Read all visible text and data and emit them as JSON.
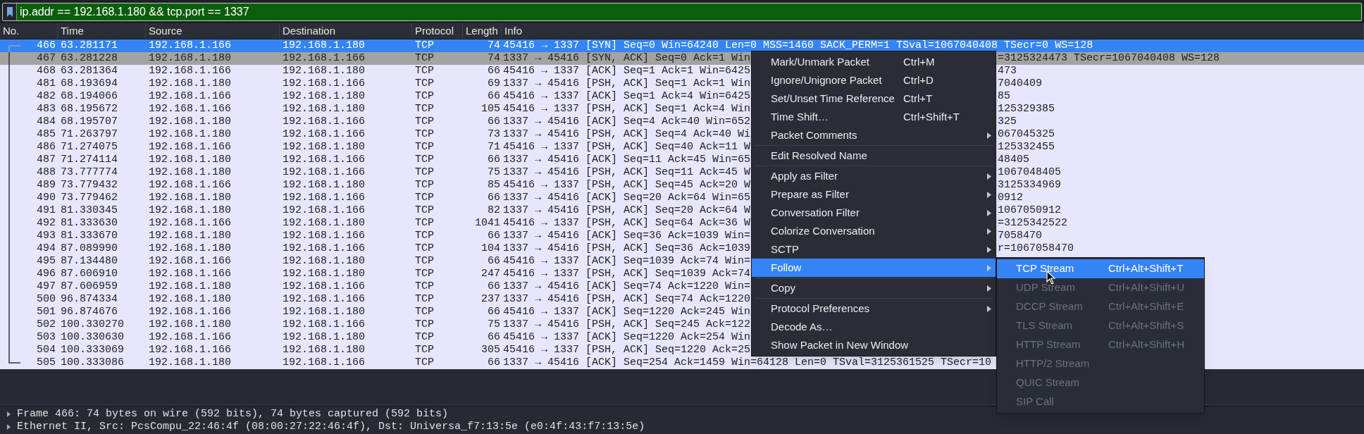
{
  "filter": {
    "value": "ip.addr == 192.168.1.180 && tcp.port == 1337"
  },
  "table": {
    "columns": [
      "No.",
      "Time",
      "Source",
      "Destination",
      "Protocol",
      "Length",
      "Info"
    ],
    "rows": [
      {
        "no": "466",
        "time": "63.281171",
        "source": "192.168.1.166",
        "destination": "192.168.1.180",
        "protocol": "TCP",
        "length": "74",
        "info": "45416 → 1337 [SYN] Seq=0 Win=64240 Len=0 MSS=1460 SACK_PERM=1 TSval=1067040408 TSecr=0 WS=128",
        "selected": true,
        "highlighted": false
      },
      {
        "no": "467",
        "time": "63.281228",
        "source": "192.168.1.180",
        "destination": "192.168.1.166",
        "protocol": "TCP",
        "length": "74",
        "info": "1337 → 45416 [SYN, ACK] Seq=0 Ack=1 Win",
        "info_tail": "=3125324473 TSecr=1067040408 WS=128",
        "selected": false,
        "highlighted": true
      },
      {
        "no": "468",
        "time": "63.281364",
        "source": "192.168.1.166",
        "destination": "192.168.1.180",
        "protocol": "TCP",
        "length": "66",
        "info": "45416 → 1337 [ACK] Seq=1 Ack=1 Win=6425",
        "info_tail": "473",
        "selected": false,
        "highlighted": false
      },
      {
        "no": "481",
        "time": "68.193694",
        "source": "192.168.1.180",
        "destination": "192.168.1.166",
        "protocol": "TCP",
        "length": "69",
        "info": "1337 → 45416 [PSH, ACK] Seq=1 Ack=1 Win",
        "info_tail": "7040409",
        "selected": false,
        "highlighted": false
      },
      {
        "no": "482",
        "time": "68.194066",
        "source": "192.168.1.166",
        "destination": "192.168.1.180",
        "protocol": "TCP",
        "length": "66",
        "info": "45416 → 1337 [ACK] Seq=1 Ack=4 Win=6425",
        "info_tail": "85",
        "selected": false,
        "highlighted": false
      },
      {
        "no": "483",
        "time": "68.195672",
        "source": "192.168.1.166",
        "destination": "192.168.1.180",
        "protocol": "TCP",
        "length": "105",
        "info": "45416 → 1337 [PSH, ACK] Seq=1 Ack=4 Win",
        "info_tail": "125329385",
        "selected": false,
        "highlighted": false
      },
      {
        "no": "484",
        "time": "68.195707",
        "source": "192.168.1.180",
        "destination": "192.168.1.166",
        "protocol": "TCP",
        "length": "66",
        "info": "1337 → 45416 [ACK] Seq=4 Ack=40 Win=652",
        "info_tail": "325",
        "selected": false,
        "highlighted": false
      },
      {
        "no": "485",
        "time": "71.263797",
        "source": "192.168.1.180",
        "destination": "192.168.1.166",
        "protocol": "TCP",
        "length": "73",
        "info": "1337 → 45416 [PSH, ACK] Seq=4 Ack=40 Wi",
        "info_tail": "067045325",
        "selected": false,
        "highlighted": false
      },
      {
        "no": "486",
        "time": "71.274075",
        "source": "192.168.1.166",
        "destination": "192.168.1.180",
        "protocol": "TCP",
        "length": "71",
        "info": "45416 → 1337 [PSH, ACK] Seq=40 Ack=11 W",
        "info_tail": "125332455",
        "selected": false,
        "highlighted": false
      },
      {
        "no": "487",
        "time": "71.274114",
        "source": "192.168.1.180",
        "destination": "192.168.1.166",
        "protocol": "TCP",
        "length": "66",
        "info": "1337 → 45416 [ACK] Seq=11 Ack=45 Win=65",
        "info_tail": "48405",
        "selected": false,
        "highlighted": false
      },
      {
        "no": "488",
        "time": "73.777774",
        "source": "192.168.1.180",
        "destination": "192.168.1.166",
        "protocol": "TCP",
        "length": "75",
        "info": "1337 → 45416 [PSH, ACK] Seq=11 Ack=45 W",
        "info_tail": "1067048405",
        "selected": false,
        "highlighted": false
      },
      {
        "no": "489",
        "time": "73.779432",
        "source": "192.168.1.166",
        "destination": "192.168.1.180",
        "protocol": "TCP",
        "length": "85",
        "info": "45416 → 1337 [PSH, ACK] Seq=45 Ack=20 W",
        "info_tail": "3125334969",
        "selected": false,
        "highlighted": false
      },
      {
        "no": "490",
        "time": "73.779462",
        "source": "192.168.1.180",
        "destination": "192.168.1.166",
        "protocol": "TCP",
        "length": "66",
        "info": "1337 → 45416 [ACK] Seq=20 Ack=64 Win=65",
        "info_tail": "0912",
        "selected": false,
        "highlighted": false
      },
      {
        "no": "491",
        "time": "81.330345",
        "source": "192.168.1.180",
        "destination": "192.168.1.166",
        "protocol": "TCP",
        "length": "82",
        "info": "1337 → 45416 [PSH, ACK] Seq=20 Ack=64 W",
        "info_tail": "1067050912",
        "selected": false,
        "highlighted": false
      },
      {
        "no": "492",
        "time": "81.333630",
        "source": "192.168.1.166",
        "destination": "192.168.1.180",
        "protocol": "TCP",
        "length": "1041",
        "info": "45416 → 1337 [PSH, ACK] Seq=64 Ack=36 W",
        "info_tail": "=3125342522",
        "selected": false,
        "highlighted": false
      },
      {
        "no": "493",
        "time": "81.333670",
        "source": "192.168.1.180",
        "destination": "192.168.1.166",
        "protocol": "TCP",
        "length": "66",
        "info": "1337 → 45416 [ACK] Seq=36 Ack=1039 Win=",
        "info_tail": "7058470",
        "selected": false,
        "highlighted": false
      },
      {
        "no": "494",
        "time": "87.089990",
        "source": "192.168.1.180",
        "destination": "192.168.1.166",
        "protocol": "TCP",
        "length": "104",
        "info": "1337 → 45416 [PSH, ACK] Seq=36 Ack=1039",
        "info_tail": "r=1067058470",
        "selected": false,
        "highlighted": false
      },
      {
        "no": "495",
        "time": "87.134480",
        "source": "192.168.1.166",
        "destination": "192.168.1.180",
        "protocol": "TCP",
        "length": "66",
        "info": "45416 → 1337 [ACK] Seq=1039 Ack=74 Win=",
        "selected": false,
        "highlighted": false
      },
      {
        "no": "496",
        "time": "87.606910",
        "source": "192.168.1.166",
        "destination": "192.168.1.180",
        "protocol": "TCP",
        "length": "247",
        "info": "45416 → 1337 [PSH, ACK] Seq=1039 Ack=74",
        "selected": false,
        "highlighted": false
      },
      {
        "no": "497",
        "time": "87.606959",
        "source": "192.168.1.180",
        "destination": "192.168.1.166",
        "protocol": "TCP",
        "length": "66",
        "info": "1337 → 45416 [ACK] Seq=74 Ack=1220 Win=",
        "selected": false,
        "highlighted": false
      },
      {
        "no": "500",
        "time": "96.874334",
        "source": "192.168.1.180",
        "destination": "192.168.1.166",
        "protocol": "TCP",
        "length": "237",
        "info": "1337 → 45416 [PSH, ACK] Seq=74 Ack=1220",
        "selected": false,
        "highlighted": false
      },
      {
        "no": "501",
        "time": "96.874676",
        "source": "192.168.1.166",
        "destination": "192.168.1.180",
        "protocol": "TCP",
        "length": "66",
        "info": "45416 → 1337 [ACK] Seq=1220 Ack=245 Win",
        "selected": false,
        "highlighted": false
      },
      {
        "no": "502",
        "time": "100.330270",
        "source": "192.168.1.180",
        "destination": "192.168.1.166",
        "protocol": "TCP",
        "length": "75",
        "info": "1337 → 45416 [PSH, ACK] Seq=245 Ack=122",
        "selected": false,
        "highlighted": false
      },
      {
        "no": "503",
        "time": "100.330630",
        "source": "192.168.1.166",
        "destination": "192.168.1.180",
        "protocol": "TCP",
        "length": "66",
        "info": "45416 → 1337 [ACK] Seq=1220 Ack=254 Win",
        "selected": false,
        "highlighted": false
      },
      {
        "no": "504",
        "time": "100.333069",
        "source": "192.168.1.166",
        "destination": "192.168.1.180",
        "protocol": "TCP",
        "length": "305",
        "info": "45416 → 1337 [PSH, ACK] Seq=1220 Ack=25",
        "selected": false,
        "highlighted": false
      },
      {
        "no": "505",
        "time": "100.333086",
        "source": "192.168.1.180",
        "destination": "192.168.1.166",
        "protocol": "TCP",
        "length": "66",
        "info": "1337 → 45416 [ACK] Seq=254 Ack=1459 Win=64128 Len=0 TSval=3125361525 TSecr=10",
        "selected": false,
        "highlighted": false
      }
    ]
  },
  "context_menu": {
    "items": [
      {
        "kind": "item",
        "label": "Mark/Unmark Packet",
        "shortcut": "Ctrl+M",
        "submenu": false,
        "selected": false
      },
      {
        "kind": "item",
        "label": "Ignore/Unignore Packet",
        "shortcut": "Ctrl+D",
        "submenu": false,
        "selected": false
      },
      {
        "kind": "item",
        "label": "Set/Unset Time Reference",
        "shortcut": "Ctrl+T",
        "submenu": false,
        "selected": false
      },
      {
        "kind": "item",
        "label": "Time Shift…",
        "shortcut": "Ctrl+Shift+T",
        "submenu": false,
        "selected": false
      },
      {
        "kind": "item",
        "label": "Packet Comments",
        "submenu": true,
        "selected": false
      },
      {
        "kind": "separator"
      },
      {
        "kind": "item",
        "label": "Edit Resolved Name",
        "submenu": false,
        "selected": false
      },
      {
        "kind": "separator"
      },
      {
        "kind": "item",
        "label": "Apply as Filter",
        "submenu": true,
        "selected": false
      },
      {
        "kind": "item",
        "label": "Prepare as Filter",
        "submenu": true,
        "selected": false
      },
      {
        "kind": "item",
        "label": "Conversation Filter",
        "submenu": true,
        "selected": false
      },
      {
        "kind": "item",
        "label": "Colorize Conversation",
        "submenu": true,
        "selected": false
      },
      {
        "kind": "item",
        "label": "SCTP",
        "submenu": true,
        "selected": false
      },
      {
        "kind": "item",
        "label": "Follow",
        "submenu": true,
        "selected": true
      },
      {
        "kind": "separator"
      },
      {
        "kind": "item",
        "label": "Copy",
        "submenu": true,
        "selected": false
      },
      {
        "kind": "separator"
      },
      {
        "kind": "item",
        "label": "Protocol Preferences",
        "submenu": true,
        "selected": false
      },
      {
        "kind": "item",
        "label": "Decode As…",
        "submenu": false,
        "selected": false
      },
      {
        "kind": "item",
        "label": "Show Packet in New Window",
        "submenu": false,
        "selected": false
      }
    ]
  },
  "follow_submenu": {
    "items": [
      {
        "label": "TCP Stream",
        "shortcut": "Ctrl+Alt+Shift+T",
        "selected": true,
        "disabled": false
      },
      {
        "label": "UDP Stream",
        "shortcut": "Ctrl+Alt+Shift+U",
        "selected": false,
        "disabled": true
      },
      {
        "label": "DCCP Stream",
        "shortcut": "Ctrl+Alt+Shift+E",
        "selected": false,
        "disabled": true
      },
      {
        "label": "TLS Stream",
        "shortcut": "Ctrl+Alt+Shift+S",
        "selected": false,
        "disabled": true
      },
      {
        "label": "HTTP Stream",
        "shortcut": "Ctrl+Alt+Shift+H",
        "selected": false,
        "disabled": true
      },
      {
        "label": "HTTP/2 Stream",
        "selected": false,
        "disabled": true
      },
      {
        "label": "QUIC Stream",
        "selected": false,
        "disabled": true
      },
      {
        "label": "SIP Call",
        "selected": false,
        "disabled": true
      }
    ]
  },
  "details": {
    "items": [
      {
        "label": "Frame 466: 74 bytes on wire (592 bits), 74 bytes captured (592 bits)",
        "expanded": false
      },
      {
        "label": "Ethernet II, Src: PcsCompu_22:46:4f (08:00:27:22:46:4f), Dst: Universa_f7:13:5e (e0:4f:43:f7:13:5e)",
        "expanded": false
      }
    ]
  }
}
